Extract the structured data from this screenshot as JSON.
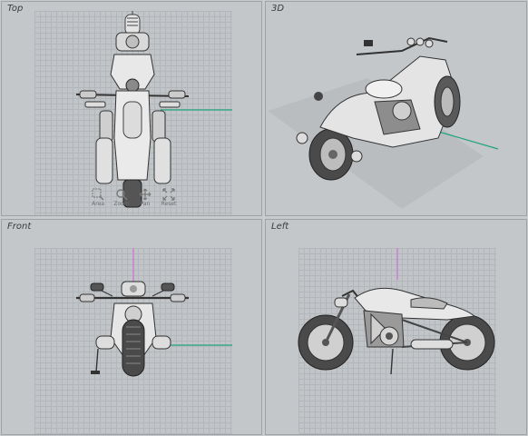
{
  "viewports": {
    "top": {
      "label": "Top"
    },
    "perspective": {
      "label": "3D"
    },
    "front": {
      "label": "Front"
    },
    "left": {
      "label": "Left"
    }
  },
  "nav_controls": {
    "area": "Area",
    "zoom": "Zoom",
    "pan": "Pan",
    "reset": "Reset"
  },
  "colors": {
    "x_axis": "#1fa57a",
    "z_axis": "#d36fd8",
    "model_light": "#e6e6e6",
    "model_dark": "#5a5a5a"
  }
}
